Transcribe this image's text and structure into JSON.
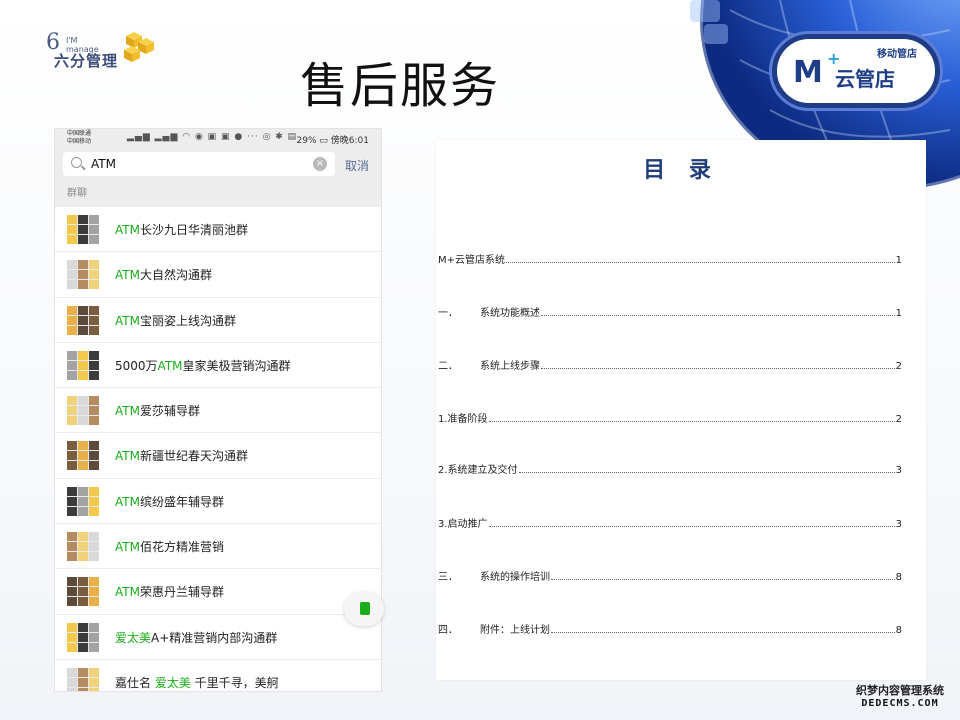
{
  "slide": {
    "title": "售后服务"
  },
  "logo_left": {
    "six": "6",
    "manage": "I'M\nmanage",
    "cn": "六分管理"
  },
  "logo_right": {
    "sub": "移动管店",
    "mark": "M",
    "plus": "+",
    "name": "云管店"
  },
  "phone": {
    "statusbar": {
      "carrier1": "中国联通",
      "carrier2": "中国移动",
      "battery": "29%",
      "time": "傍晚6:01"
    },
    "search": {
      "value": "ATM",
      "cancel_label": "取消"
    },
    "section_label": "群聊",
    "groups": [
      {
        "pre": "",
        "hl": "ATM",
        "post": "长沙九日华清丽池群"
      },
      {
        "pre": "",
        "hl": "ATM",
        "post": "大自然沟通群"
      },
      {
        "pre": "",
        "hl": "ATM",
        "post": "宝丽姿上线沟通群"
      },
      {
        "pre": "5000万",
        "hl": "ATM",
        "post": "皇家美极营销沟通群"
      },
      {
        "pre": "",
        "hl": "ATM",
        "post": "爱莎辅导群"
      },
      {
        "pre": "",
        "hl": "ATM",
        "post": "新疆世纪春天沟通群"
      },
      {
        "pre": "",
        "hl": "ATM",
        "post": "缤纷盛年辅导群"
      },
      {
        "pre": "",
        "hl": "ATM",
        "post": "佰花方精准营销"
      },
      {
        "pre": "",
        "hl": "ATM",
        "post": "荣惠丹兰辅导群"
      },
      {
        "pre": "",
        "hl": "爱太美",
        "post": "A+精准营销内部沟通群"
      },
      {
        "pre": "嘉仕名 ",
        "hl": "爱太美",
        "post": " 千里千寻，美舸"
      }
    ]
  },
  "toc": {
    "title": "目 录",
    "entries": [
      {
        "num": "",
        "label": "M+云管店系统",
        "page": "1"
      },
      {
        "num": "一．",
        "label": "系统功能概述",
        "page": "1"
      },
      {
        "num": "二．",
        "label": "系统上线步骤",
        "page": "2"
      },
      {
        "num": "",
        "label": "1.准备阶段",
        "page": "2"
      },
      {
        "num": "",
        "label": "2.系统建立及交付",
        "page": "3"
      },
      {
        "num": "",
        "label": "3.启动推广",
        "page": "3"
      },
      {
        "num": "三．",
        "label": "系统的操作培训",
        "page": "8"
      },
      {
        "num": "四．",
        "label": "附件：上线计划",
        "page": "8"
      }
    ]
  },
  "watermark": {
    "line1": "织梦内容管理系统",
    "line2": "DEDECMS.COM"
  }
}
